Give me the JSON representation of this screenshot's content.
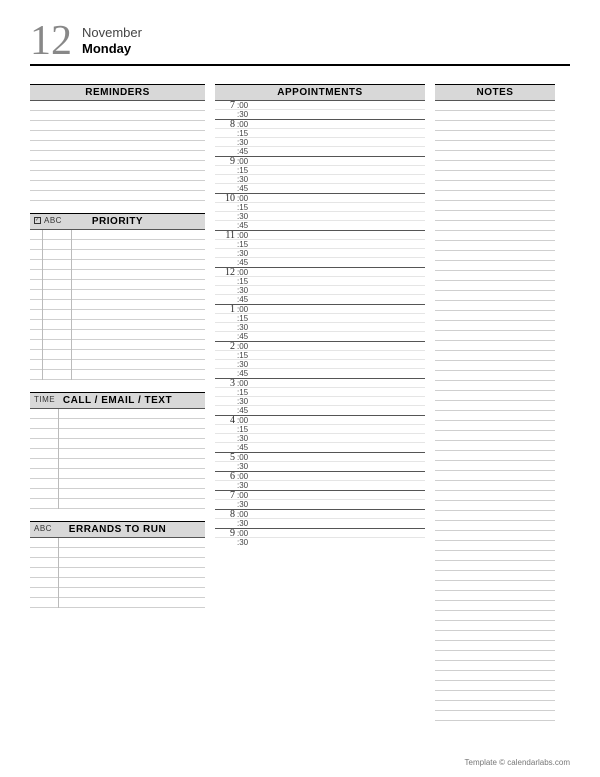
{
  "date": {
    "day_number": "12",
    "month": "November",
    "weekday": "Monday"
  },
  "sections": {
    "reminders": {
      "title": "REMINDERS"
    },
    "priority": {
      "title": "PRIORITY",
      "sub_check": "☑",
      "sub_label": "ABC"
    },
    "call": {
      "title": "CALL / EMAIL / TEXT",
      "sub_label": "TIME"
    },
    "errands": {
      "title": "ERRANDS TO RUN",
      "sub_label": "ABC"
    },
    "appointments": {
      "title": "APPOINTMENTS"
    },
    "notes": {
      "title": "NOTES"
    }
  },
  "appointments": {
    "hours": [
      {
        "label": "7",
        "slots": [
          ":00",
          ":30"
        ]
      },
      {
        "label": "8",
        "slots": [
          ":00",
          ":15",
          ":30",
          ":45"
        ]
      },
      {
        "label": "9",
        "slots": [
          ":00",
          ":15",
          ":30",
          ":45"
        ]
      },
      {
        "label": "10",
        "slots": [
          ":00",
          ":15",
          ":30",
          ":45"
        ]
      },
      {
        "label": "11",
        "slots": [
          ":00",
          ":15",
          ":30",
          ":45"
        ]
      },
      {
        "label": "12",
        "slots": [
          ":00",
          ":15",
          ":30",
          ":45"
        ]
      },
      {
        "label": "1",
        "slots": [
          ":00",
          ":15",
          ":30",
          ":45"
        ]
      },
      {
        "label": "2",
        "slots": [
          ":00",
          ":15",
          ":30",
          ":45"
        ]
      },
      {
        "label": "3",
        "slots": [
          ":00",
          ":15",
          ":30",
          ":45"
        ]
      },
      {
        "label": "4",
        "slots": [
          ":00",
          ":15",
          ":30",
          ":45"
        ]
      },
      {
        "label": "5",
        "slots": [
          ":00",
          ":30"
        ]
      },
      {
        "label": "6",
        "slots": [
          ":00",
          ":30"
        ]
      },
      {
        "label": "7",
        "slots": [
          ":00",
          ":30"
        ]
      },
      {
        "label": "8",
        "slots": [
          ":00",
          ":30"
        ]
      },
      {
        "label": "9",
        "slots": [
          ":00",
          ":30"
        ]
      }
    ]
  },
  "footer": "Template © calendarlabs.com"
}
